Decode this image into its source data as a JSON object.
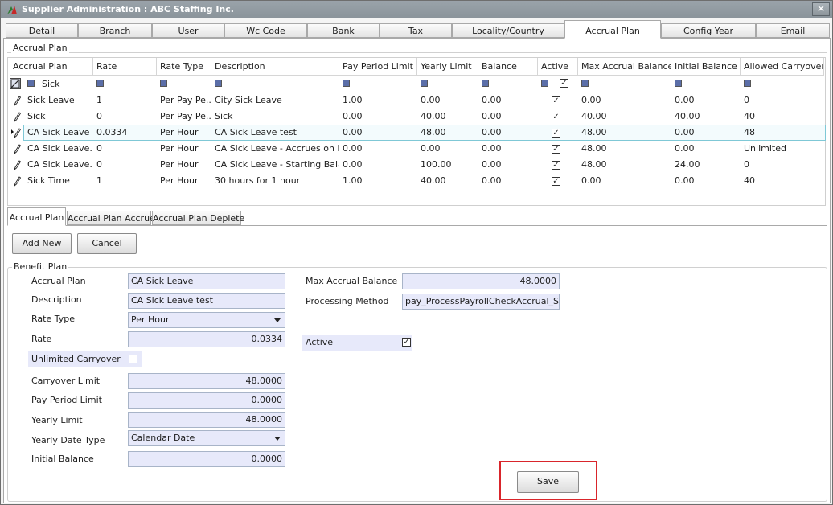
{
  "window": {
    "title": "Supplier Administration : ABC Staffing Inc.",
    "close_glyph": "✕"
  },
  "tabs": [
    {
      "label": "Detail"
    },
    {
      "label": "Branch"
    },
    {
      "label": "User"
    },
    {
      "label": "Wc Code"
    },
    {
      "label": "Bank"
    },
    {
      "label": "Tax"
    },
    {
      "label": "Locality/Country"
    },
    {
      "label": "Accrual Plan"
    },
    {
      "label": "Config Year"
    },
    {
      "label": "Email"
    }
  ],
  "grid": {
    "group_label": "Accrual Plan",
    "columns": [
      "Accrual Plan",
      "Rate",
      "Rate Type",
      "Description",
      "Pay Period Limit",
      "Yearly Limit",
      "Balance",
      "Active",
      "Max Accrual Balance",
      "Initial Balance",
      "Allowed Carryover"
    ],
    "filter_text": "Sick",
    "rows": [
      {
        "plan": "Sick Leave",
        "rate": "1",
        "rate_type": "Per Pay Pe...",
        "description": "City Sick Leave",
        "pay_period_limit": "1.00",
        "yearly_limit": "0.00",
        "balance": "0.00",
        "active": true,
        "max_accrual": "0.00",
        "initial_balance": "0.00",
        "carryover": "0"
      },
      {
        "plan": "Sick",
        "rate": "0",
        "rate_type": "Per Pay Pe...",
        "description": "Sick",
        "pay_period_limit": "0.00",
        "yearly_limit": "40.00",
        "balance": "0.00",
        "active": true,
        "max_accrual": "40.00",
        "initial_balance": "40.00",
        "carryover": "40"
      },
      {
        "plan": "CA Sick Leave",
        "rate": "0.0334",
        "rate_type": "Per Hour",
        "description": "CA Sick Leave test",
        "pay_period_limit": "0.00",
        "yearly_limit": "48.00",
        "balance": "0.00",
        "active": true,
        "max_accrual": "48.00",
        "initial_balance": "0.00",
        "carryover": "48"
      },
      {
        "plan": "CA Sick Leave...",
        "rate": "0",
        "rate_type": "Per Hour",
        "description": "CA Sick Leave - Accrues on h...",
        "pay_period_limit": "0.00",
        "yearly_limit": "0.00",
        "balance": "0.00",
        "active": true,
        "max_accrual": "48.00",
        "initial_balance": "0.00",
        "carryover": "Unlimited"
      },
      {
        "plan": "CA Sick Leave...",
        "rate": "0",
        "rate_type": "Per Hour",
        "description": "CA Sick Leave - Starting Bala...",
        "pay_period_limit": "0.00",
        "yearly_limit": "100.00",
        "balance": "0.00",
        "active": true,
        "max_accrual": "48.00",
        "initial_balance": "24.00",
        "carryover": "0"
      },
      {
        "plan": "Sick Time",
        "rate": "1",
        "rate_type": "Per Hour",
        "description": "30 hours for 1 hour",
        "pay_period_limit": "1.00",
        "yearly_limit": "40.00",
        "balance": "0.00",
        "active": true,
        "max_accrual": "0.00",
        "initial_balance": "0.00",
        "carryover": "40"
      }
    ]
  },
  "subtabs": [
    {
      "label": "Accrual  Plan"
    },
    {
      "label": "Accrual Plan Accrue"
    },
    {
      "label": "Accrual Plan Deplete"
    }
  ],
  "buttons": {
    "add_new": "Add New",
    "cancel": "Cancel",
    "save": "Save"
  },
  "form": {
    "group_label": "Benefit Plan",
    "accrual_plan": {
      "label": "Accrual Plan",
      "value": "CA Sick Leave"
    },
    "description": {
      "label": "Description",
      "value": "CA Sick Leave test"
    },
    "rate_type": {
      "label": "Rate Type",
      "value": "Per Hour"
    },
    "rate": {
      "label": "Rate",
      "value": "0.0334"
    },
    "unlimited_carryover": {
      "label": "Unlimited Carryover",
      "checked": false
    },
    "carryover_limit": {
      "label": "Carryover Limit",
      "value": "48.0000"
    },
    "pay_period_limit": {
      "label": "Pay Period Limit",
      "value": "0.0000"
    },
    "yearly_limit": {
      "label": "Yearly Limit",
      "value": "48.0000"
    },
    "yearly_date_type": {
      "label": "Yearly Date Type",
      "value": "Calendar Date"
    },
    "initial_balance": {
      "label": "Initial Balance",
      "value": "0.0000"
    },
    "max_accrual_balance": {
      "label": "Max Accrual Balance",
      "value": "48.0000"
    },
    "processing_method": {
      "label": "Processing Method",
      "value": "pay_ProcessPayrollCheckAccrual_SickL"
    },
    "active": {
      "label": "Active",
      "checked": true
    }
  },
  "colors": {
    "highlight": "#d9252b",
    "input_bg": "#e7e9fa",
    "selected_row": "#7fc8d6"
  }
}
